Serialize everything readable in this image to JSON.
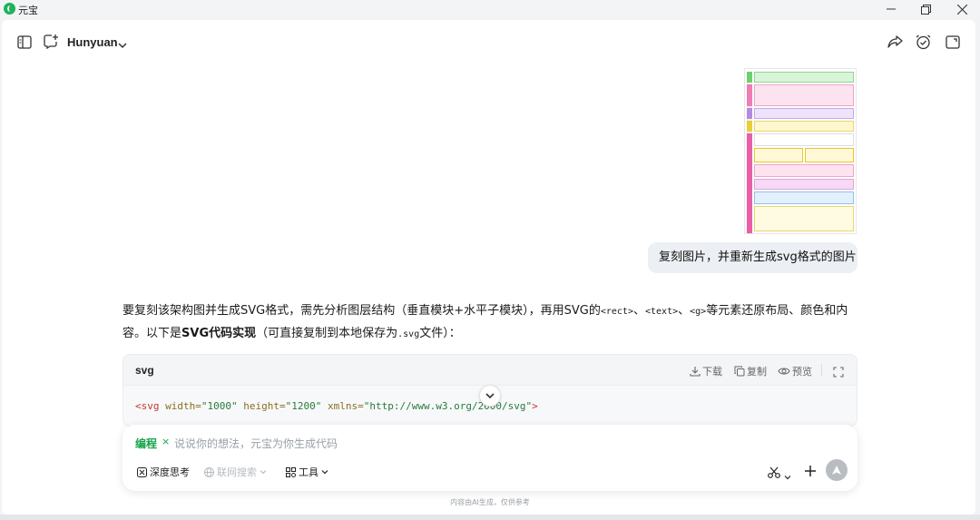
{
  "window": {
    "title": "元宝",
    "controls": [
      "minimize-icon",
      "restore-icon",
      "close-icon"
    ]
  },
  "header": {
    "model_name": "Hunyuan",
    "icons": [
      "sidebar-toggle-icon",
      "new-chat-icon",
      "chevron-down-icon",
      "share-icon",
      "alarm-icon",
      "window-icon"
    ]
  },
  "conversation": {
    "user_message": "复刻图片，并重新生成svg格式的图片",
    "assistant_reply": {
      "line1_text": "要复刻该架构图并生成SVG格式，需先分析图层结构（垂直模块+水平子模块），再用SVG的",
      "code_rect": "<rect>",
      "sep1": "、",
      "code_text": "<text>",
      "sep2": "、",
      "code_g": "<g>",
      "line1_tail": "等元素还原布局、颜色和内",
      "line2_head": "容。以下是",
      "line2_bold": "SVG代码实现",
      "line2_mid": "（可直接复制到本地保存为",
      "code_ext": ".svg",
      "line2_tail": "文件）："
    }
  },
  "code_block": {
    "language": "svg",
    "download": "下载",
    "copy": "复制",
    "preview": "预览",
    "line_tag": "<svg",
    "attr_width": "width=",
    "val_width": "\"1000\"",
    "attr_height": "height=",
    "val_height": "\"1200\"",
    "attr_xmlns": "xmlns=",
    "val_xmlns": "\"http://www.w3.org/2000/svg\"",
    "line_close": ">"
  },
  "composer": {
    "mode_label": "编程",
    "mode_remove": "×",
    "placeholder": "说说你的想法，元宝为你生成代码",
    "tools": {
      "deep_think": "深度思考",
      "web_search": "联网搜索",
      "tools": "工具"
    }
  },
  "footer_note": "内容由AI生成，仅供参考",
  "colors": {
    "accent_green": "#17a34a",
    "bubble_bg": "#eceff3",
    "send_disabled": "#b9bcc1"
  }
}
